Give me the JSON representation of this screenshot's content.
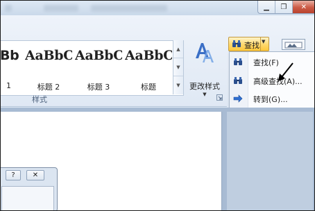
{
  "window": {
    "minimize_glyph": "▁",
    "restore_glyph": "❐",
    "close_glyph": "✕"
  },
  "styles_group": {
    "label": "样式",
    "items": [
      {
        "sample": "Bb",
        "name": "1"
      },
      {
        "sample": "AaBbC",
        "name": "标题 2"
      },
      {
        "sample": "AaBbC",
        "name": "标题 3"
      },
      {
        "sample": "AaBbC",
        "name": "标题"
      }
    ],
    "change_styles_label": "更改样式",
    "change_styles_icon": "styles-aa-icon",
    "dropdown_glyph": "▼"
  },
  "editing": {
    "find_button_label": "查找",
    "find_icon": "binoculars-icon",
    "menu": [
      {
        "label": "查找(F)",
        "icon": "binoculars-icon"
      },
      {
        "label": "高级查找(A)...",
        "icon": "binoculars-icon"
      },
      {
        "label": "转到(G)...",
        "icon": "arrow-right-icon"
      }
    ]
  },
  "dialog": {
    "help_glyph": "?",
    "close_glyph": "✕"
  },
  "colors": {
    "accent_highlight": "#ffd86b",
    "goto_arrow": "#2f6fd1",
    "binocular_lens": "#2a4f8e"
  }
}
